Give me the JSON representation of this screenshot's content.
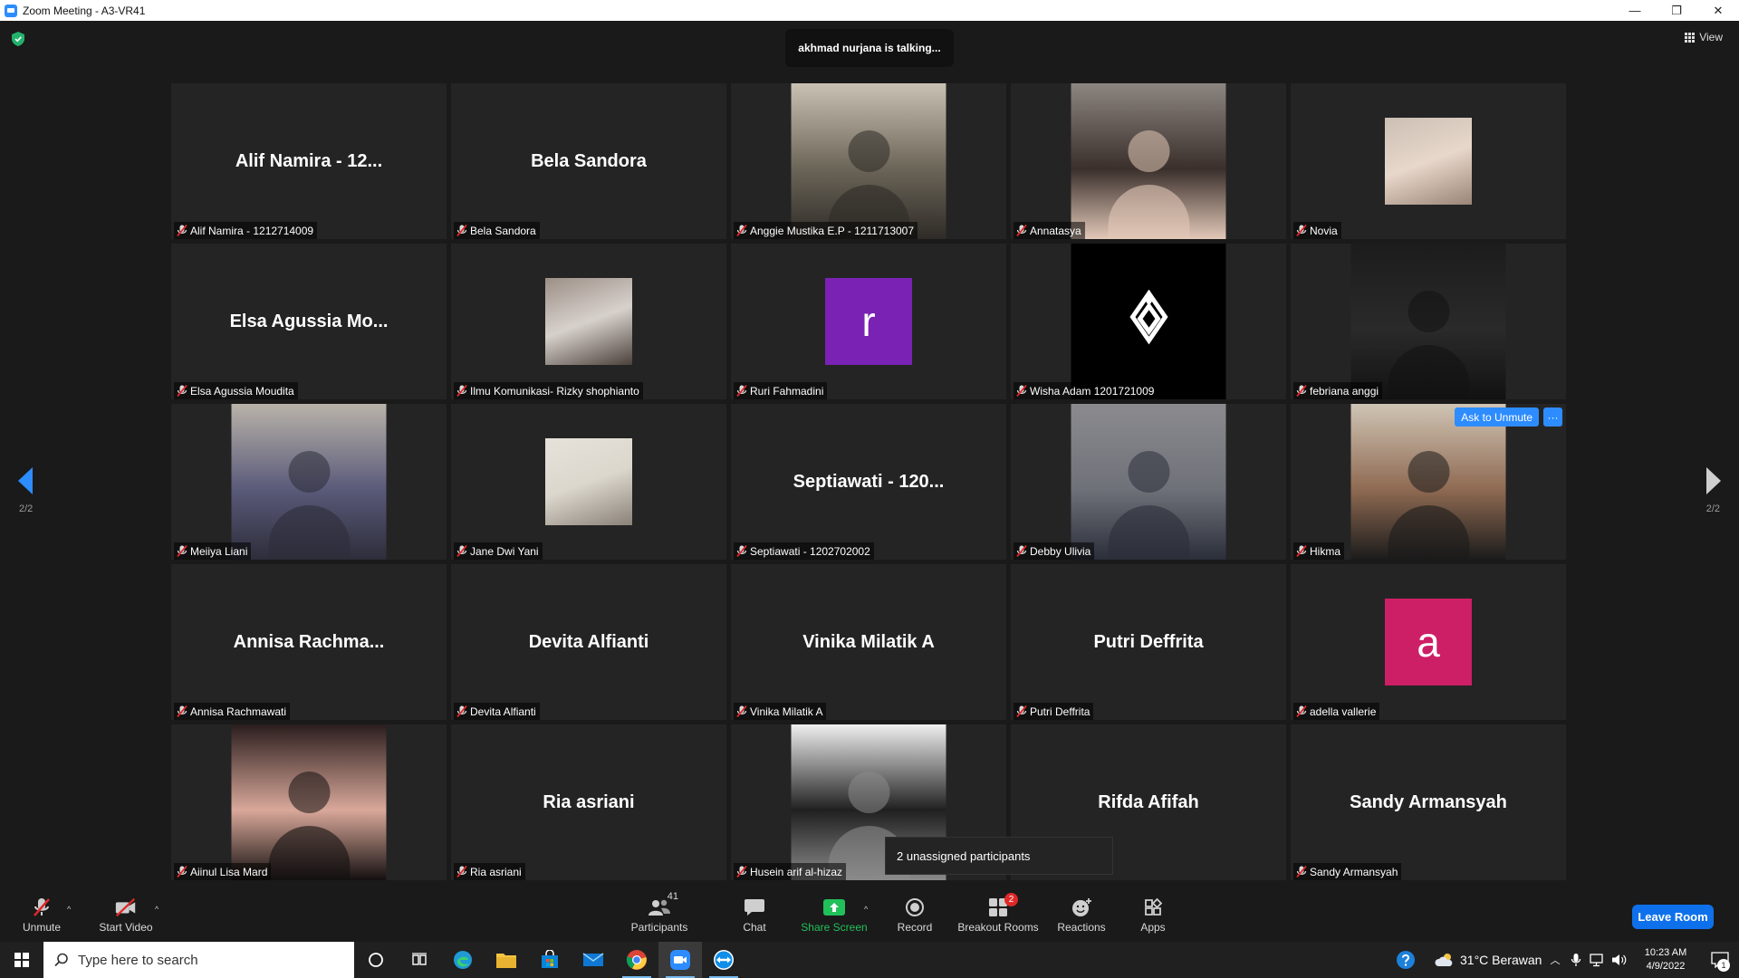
{
  "window": {
    "title": "Zoom Meeting - A3-VR41",
    "controls": [
      "—",
      "❐",
      "✕"
    ]
  },
  "meeting": {
    "talking_banner": "akhmad nurjana is talking...",
    "view_label": "View",
    "page_indicator_left": "2/2",
    "page_indicator_right": "2/2",
    "ask_to_unmute": "Ask to Unmute",
    "more_label": "···",
    "unassigned_popup": "2 unassigned participants"
  },
  "participants": [
    {
      "label": "Alif Namira - 1212714009",
      "display": "Alif Namira - 12...",
      "kind": "name"
    },
    {
      "label": "Bela Sandora",
      "display": "Bela Sandora",
      "kind": "name"
    },
    {
      "label": "Anggie Mustika E.P - 1211713007",
      "display": "",
      "kind": "photo",
      "colors": [
        "#c9c1b4",
        "#6b6558",
        "#2f2b27"
      ]
    },
    {
      "label": "Annatasya",
      "display": "",
      "kind": "photo",
      "colors": [
        "#8d8680",
        "#3a2f2b",
        "#e2c8b8"
      ]
    },
    {
      "label": "Novia",
      "display": "",
      "kind": "thumb",
      "colors": [
        "#cbbfb3",
        "#e8d7cb",
        "#9a8576"
      ]
    },
    {
      "label": "Elsa Agussia Moudita",
      "display": "Elsa Agussia Mo...",
      "kind": "name"
    },
    {
      "label": "Ilmu Komunikasi- Rizky shophianto",
      "display": "",
      "kind": "thumb",
      "colors": [
        "#9c8f86",
        "#d7d1cc",
        "#4c413b"
      ]
    },
    {
      "label": "Ruri Fahmadini",
      "display": "r",
      "kind": "avatar",
      "colors": [
        "#7a22b3"
      ]
    },
    {
      "label": "Wisha Adam 1201721009",
      "display": "",
      "kind": "logo",
      "colors": [
        "#000000"
      ]
    },
    {
      "label": "febriana anggi",
      "display": "",
      "kind": "photo",
      "colors": [
        "#1c1c1c",
        "#2a2a2a",
        "#121212"
      ]
    },
    {
      "label": "Meiiya Liani",
      "display": "",
      "kind": "photo",
      "colors": [
        "#b9b3a9",
        "#5a5a7a",
        "#2d2d3a"
      ]
    },
    {
      "label": "Jane Dwi Yani",
      "display": "",
      "kind": "thumb",
      "colors": [
        "#e6e2da",
        "#dcd7cd",
        "#8a8278"
      ]
    },
    {
      "label": "Septiawati - 1202702002",
      "display": "Septiawati - 120...",
      "kind": "name"
    },
    {
      "label": "Debby Ulivia",
      "display": "",
      "kind": "photo",
      "colors": [
        "#8b8b8f",
        "#6f7179",
        "#2b2f3a"
      ]
    },
    {
      "label": "Hikma",
      "display": "",
      "kind": "photo",
      "colors": [
        "#cfc4b4",
        "#8f6a52",
        "#1b1b1b"
      ]
    },
    {
      "label": "Annisa Rachmawati",
      "display": "Annisa  Rachma...",
      "kind": "name"
    },
    {
      "label": "Devita Alfianti",
      "display": "Devita Alfianti",
      "kind": "name"
    },
    {
      "label": "Vinika Milatik A",
      "display": "Vinika Milatik A",
      "kind": "name"
    },
    {
      "label": "Putri Deffrita",
      "display": "Putri Deffrita",
      "kind": "name"
    },
    {
      "label": "adella vallerie",
      "display": "a",
      "kind": "avatar",
      "colors": [
        "#cc1f66"
      ]
    },
    {
      "label": "Aiinul Lisa Mard",
      "display": "",
      "kind": "photo",
      "colors": [
        "#2a1d1d",
        "#d9a89a",
        "#141010"
      ]
    },
    {
      "label": "Ria asriani",
      "display": "Ria asriani",
      "kind": "name"
    },
    {
      "label": "Husein arif al-hizaz",
      "display": "",
      "kind": "photo",
      "colors": [
        "#efefef",
        "#202020",
        "#8a8a8a"
      ]
    },
    {
      "label": "",
      "display": "Rifda Afifah",
      "kind": "name"
    },
    {
      "label": "Sandy Armansyah",
      "display": "Sandy Armansyah",
      "kind": "name"
    }
  ],
  "toolbar": {
    "unmute": "Unmute",
    "start_video": "Start Video",
    "participants": "Participants",
    "participants_count": "41",
    "chat": "Chat",
    "share_screen": "Share Screen",
    "record": "Record",
    "breakout_rooms": "Breakout Rooms",
    "breakout_badge": "2",
    "reactions": "Reactions",
    "apps": "Apps",
    "leave_room": "Leave Room"
  },
  "taskbar": {
    "search_placeholder": "Type here to search",
    "weather": "31°C  Berawan",
    "time": "10:23 AM",
    "date": "4/9/2022",
    "notification_count": "1"
  },
  "colors": {
    "accent": "#2d8cff",
    "share_green": "#21c05a",
    "leave_blue": "#0e71eb",
    "muted_red": "#e02828"
  }
}
